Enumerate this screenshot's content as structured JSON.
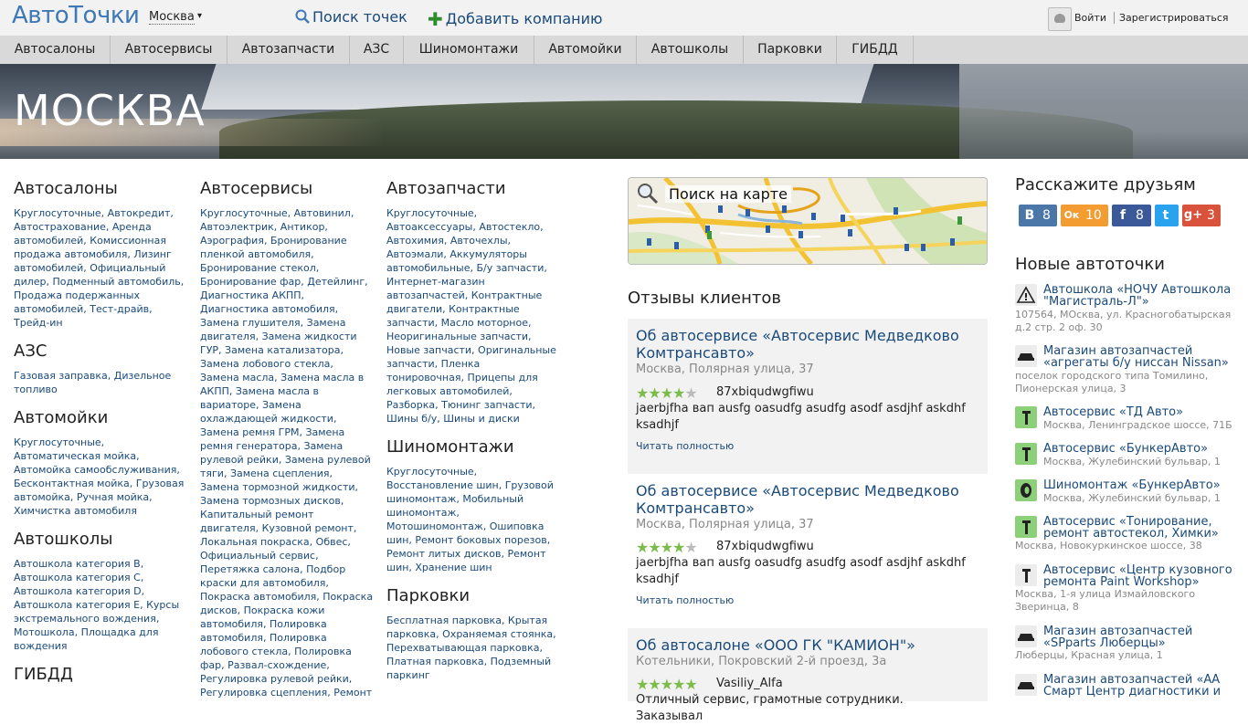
{
  "header": {
    "logo": "АвтоТочки",
    "city": "Москва",
    "city_arrow": "▾",
    "search_link": "Поиск точек",
    "add_link": "Добавить компанию",
    "add_plus": "✚",
    "login": "Войти",
    "register": "Зарегистрироваться"
  },
  "nav": {
    "items": [
      "Автосалоны",
      "Автосервисы",
      "Автозапчасти",
      "АЗС",
      "Шиномонтажи",
      "Автомойки",
      "Автошколы",
      "Парковки",
      "ГИБДД"
    ]
  },
  "banner": {
    "title": "МОСКВА"
  },
  "categories": {
    "c1": {
      "title": "Автосалоны",
      "links": "Круглосуточные, Автокредит, Автострахование, Аренда автомобилей, Комиссионная продажа автомобиля, Лизинг автомобилей, Официальный дилер, Подменный автомобиль, Продажа подержанных автомобилей, Тест-драйв, Трейд-ин"
    },
    "c2": {
      "title": "АЗС",
      "links": "Газовая заправка, Дизельное топливо"
    },
    "c3": {
      "title": "Автомойки",
      "links": "Круглосуточные, Автоматическая мойка, Автомойка самообслуживания, Бесконтактная мойка, Грузовая автомойка, Ручная мойка, Химчистка автомобиля"
    },
    "c4": {
      "title": "Автошколы",
      "links": "Автошкола категория B, Автошкола категория C, Автошкола категория D, Автошкола категория E, Курсы экстремального вождения, Мотошкола, Площадка для вождения"
    },
    "c5": {
      "title": "ГИБДД"
    },
    "c6": {
      "title": "Автосервисы",
      "links": "Круглосуточные, Автовинил, Автоэлектрик, Антикор, Аэрография, Бронирование пленкой автомобиля, Бронирование стекол, Бронирование фар, Детейлинг, Диагностика АКПП, Диагностика автомобиля, Замена глушителя, Замена двигателя, Замена жидкости ГУР, Замена катализатора, Замена лобового стекла, Замена масла, Замена масла в АКПП, Замена масла в вариаторе, Замена охлаждающей жидкости, Замена ремня ГРМ, Замена ремня генератора, Замена рулевой рейки, Замена рулевой тяги, Замена сцепления, Замена тормозной жидкости, Замена тормозных дисков, Капитальный ремонт двигателя, Кузовной ремонт, Локальная покраска, Обвес, Официальный сервис, Перетяжка салона, Подбор краски для автомобиля, Покраска автомобиля, Покраска дисков, Покраска кожи автомобиля, Полировка автомобиля, Полировка лобового стекла, Полировка фар, Развал-схождение, Регулировка рулевой рейки, Регулировка сцепления, Ремонт"
    },
    "c7": {
      "title": "Автозапчасти",
      "links": "Круглосуточные, Автоаксессуары, Автостекло, Автохимия, Авточехлы, Автоэмали, Аккумуляторы автомобильные, Б/у запчасти, Интернет-магазин автозапчастей, Контрактные двигатели, Контрактные запчасти, Масло моторное, Неоригинальные запчасти, Новые запчасти, Оригинальные запчасти, Пленка тонировочная, Прицепы для легковых автомобилей, Разборка, Тюнинг запчасти, Шины б/у, Шины и диски"
    },
    "c8": {
      "title": "Шиномонтажи",
      "links": "Круглосуточные, Восстановление шин, Грузовой шиномонтаж, Мобильный шиномонтаж, Мотошиномонтаж, Ошиповка шин, Ремонт боковых порезов, Ремонт литых дисков, Ремонт шин, Хранение шин"
    },
    "c9": {
      "title": "Парковки",
      "links": "Бесплатная парковка, Крытая парковка, Охраняемая стоянка, Перехватывающая парковка, Платная парковка, Подземный паркинг"
    }
  },
  "map": {
    "label": "Поиск на карте"
  },
  "reviews": {
    "title": "Отзывы клиентов",
    "items": [
      {
        "title": "Об автосервисе «Автосервис Медведково Комтрансавто»",
        "address": "Москва, Полярная улица, 37",
        "rating": 4,
        "author": "87xbiqudwgfiwu",
        "text": "jaerbjfha вап ausfg oasudfg asudfg asodf asdjhf askdhf ksadhjf",
        "more": "Читать полностью"
      },
      {
        "title": "Об автосервисе «Автосервис Медведково Комтрансавто»",
        "address": "Москва, Полярная улица, 37",
        "rating": 4,
        "author": "87xbiqudwgfiwu",
        "text": "jaerbjfha вап ausfg oasudfg asudfg asodf asdjhf askdhf ksadhjf",
        "more": "Читать полностью"
      },
      {
        "title": "Об автосалоне «ООО ГК \"КАМИОН\"»",
        "address": "Котельники, Покровский 2-й проезд, 3а",
        "rating": 5,
        "author": "Vasiliy_Alfa",
        "text": "Отличный сервис, грамотные сотрудники. Заказывал"
      }
    ]
  },
  "share": {
    "title": "Расскажите друзьям",
    "buttons": [
      {
        "icon": "В",
        "count": "8",
        "color": "#4a76a8"
      },
      {
        "icon": "Ок",
        "count": "10",
        "color": "#f39c32"
      },
      {
        "icon": "f",
        "count": "8",
        "color": "#3b5998"
      },
      {
        "icon": "t",
        "count": "",
        "color": "#2aa3ef"
      },
      {
        "icon": "g+",
        "count": "3",
        "color": "#d9533c"
      }
    ]
  },
  "new_points": {
    "title": "Новые автоточки",
    "items": [
      {
        "name": "Автошкола «НОЧУ Автошкола \"Магистраль-Л\"»",
        "address": "107564, МОсква, ул. Красногобатырская д.2 стр. 2 оф. 30",
        "icon": "warning-sign-icon",
        "color": "#ececec"
      },
      {
        "name": "Магазин автозапчастей «агрегаты б/у ниссан Nissan»",
        "address": "поселок городского типа Томилино, Пионерская улица, 3",
        "icon": "car-icon",
        "color": "#ececec"
      },
      {
        "name": "Автосервис «ТД Авто»",
        "address": "Москва, Ленинградское шоссе, 71Б",
        "icon": "wrench-icon",
        "color": "#8cd07a"
      },
      {
        "name": "Автосервис «БункерАвто»",
        "address": "Москва, Жулебинский бульвар, 1",
        "icon": "wrench-icon",
        "color": "#8cd07a"
      },
      {
        "name": "Шиномонтаж «БункерАвто»",
        "address": "Москва, Жулебинский бульвар, 1",
        "icon": "tire-icon",
        "color": "#8cd07a"
      },
      {
        "name": "Автосервис «Тонирование, ремонт автостекол, Химки»",
        "address": "Москва, Новокуркинское шоссе, 38",
        "icon": "wrench-icon",
        "color": "#8cd07a"
      },
      {
        "name": "Автосервис «Центр кузовного ремонта Paint Workshop»",
        "address": "Москва, 1-я улица Измайловского Зверинца, 8",
        "icon": "wrench-icon",
        "color": "#ececec"
      },
      {
        "name": "Магазин автозапчастей «SPparts Люберцы»",
        "address": "Люберцы, Красная улица, 1",
        "icon": "car-icon",
        "color": "#ececec"
      },
      {
        "name": "Магазин автозапчастей «АА Смарт Центр диагностики и",
        "address": "",
        "icon": "car-icon",
        "color": "#ececec"
      }
    ]
  }
}
